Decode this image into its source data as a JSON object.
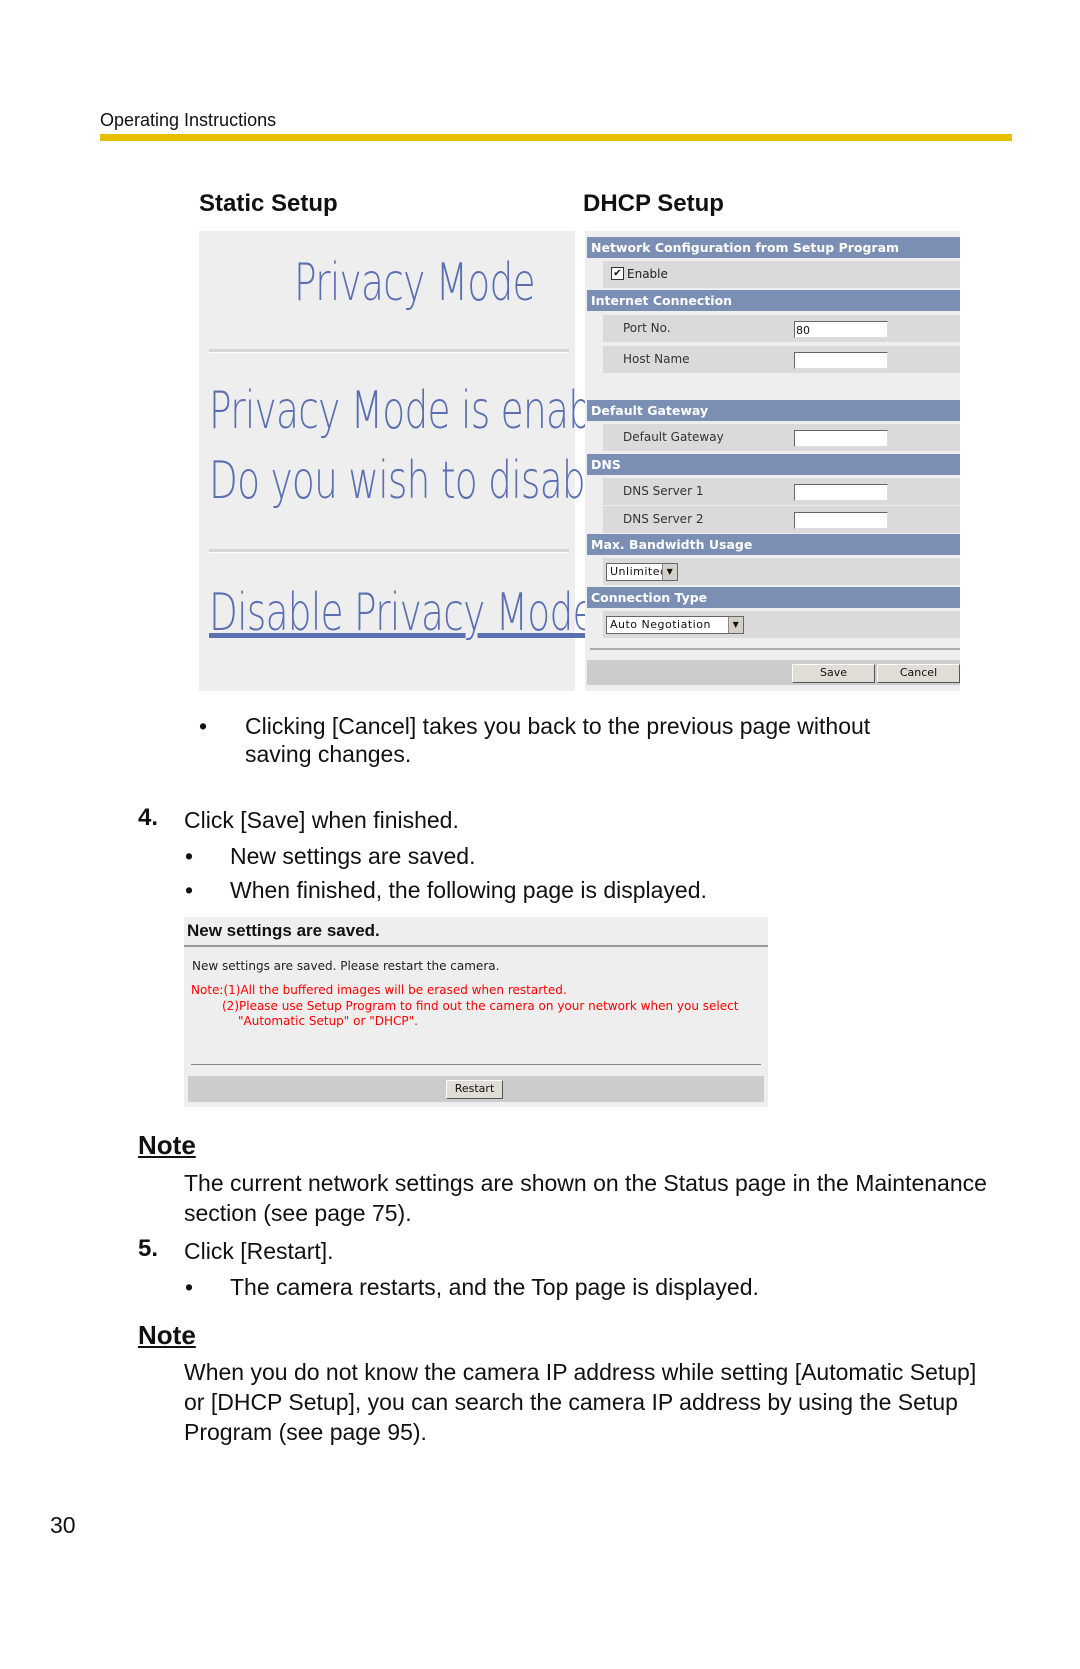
{
  "header": {
    "title": "Operating Instructions",
    "accent": "#e6c000"
  },
  "static_setup": {
    "heading": "Static Setup",
    "title": "Privacy Mode",
    "message_line1": "Privacy Mode is enabled.",
    "message_line2": "Do you wish to disable?",
    "link": "Disable Privacy Mode"
  },
  "dhcp_setup": {
    "heading": "DHCP Setup",
    "sections": {
      "network_config": "Network Configuration from Setup Program",
      "internet": "Internet Connection",
      "gateway": "Default Gateway",
      "dns": "DNS",
      "bandwidth": "Max. Bandwidth Usage",
      "connection": "Connection Type"
    },
    "enable_label": "Enable",
    "enable_checked": true,
    "port_label": "Port No.",
    "port_value": "80",
    "host_label": "Host Name",
    "host_value": "",
    "gateway_label": "Default Gateway",
    "dns1_label": "DNS Server 1",
    "dns2_label": "DNS Server 2",
    "bandwidth_value": "Unlimited",
    "connection_value": "Auto Negotiation",
    "save": "Save",
    "cancel": "Cancel"
  },
  "bullet_cancel_1": "Clicking [Cancel] takes you back to the previous page without",
  "bullet_cancel_2": "saving changes.",
  "step4": {
    "num": "4.",
    "text": "Click [Save] when finished.",
    "b1": "New settings are saved.",
    "b2": "When finished, the following page is displayed."
  },
  "saved_panel": {
    "title": "New settings are saved.",
    "message": "New settings are saved. Please restart the camera.",
    "note1": "Note:(1)All the buffered images will be erased when restarted.",
    "note2": "(2)Please use Setup Program to find out the camera on your network when you select",
    "note3": "\"Automatic Setup\" or \"DHCP\".",
    "restart": "Restart"
  },
  "note1": {
    "title": "Note",
    "l1": "The current network settings are shown on the Status page in the Maintenance",
    "l2": "section (see page 75)."
  },
  "step5": {
    "num": "5.",
    "text": "Click [Restart].",
    "b1": "The camera restarts, and the Top page is displayed."
  },
  "note2": {
    "title": "Note",
    "l1": "When you do not know the camera IP address while setting [Automatic Setup]",
    "l2": "or [DHCP Setup], you can search the camera IP address by using the Setup",
    "l3": "Program (see page 95)."
  },
  "bullet": "•",
  "page_number": "30"
}
